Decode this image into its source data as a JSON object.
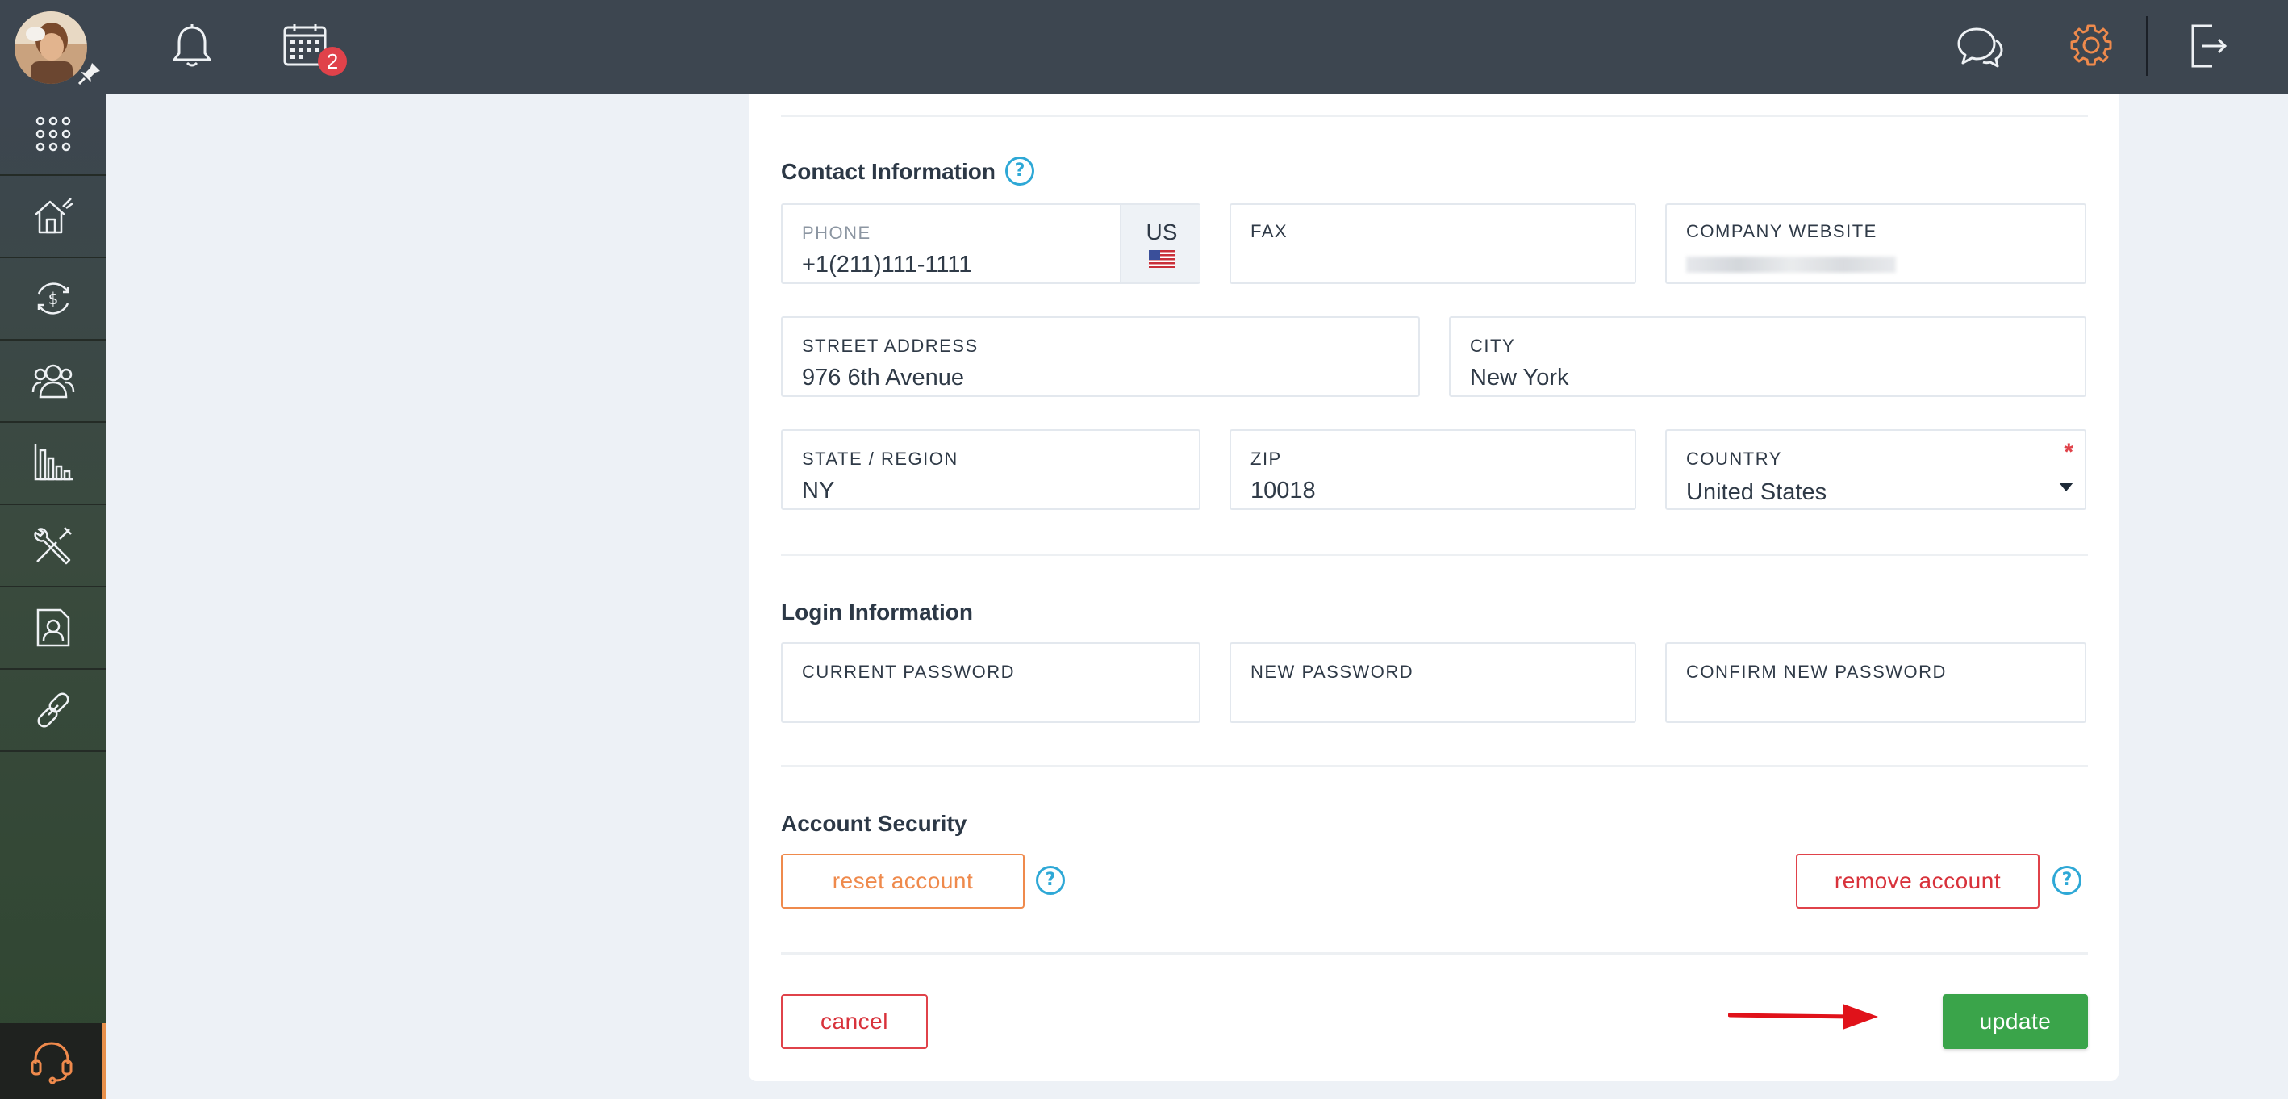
{
  "topbar": {
    "notifications_badge": "2",
    "icons": [
      "bell-icon",
      "calendar-icon",
      "chat-icon",
      "gear-icon",
      "logout-icon"
    ],
    "gear_color": "#ef8a4c"
  },
  "sidebar": {
    "items": [
      "apps-grid-icon",
      "house-icon",
      "dollar-cycle-icon",
      "users-icon",
      "chart-icon",
      "tools-icon",
      "contact-card-icon",
      "link-icon"
    ],
    "support_icon": "headset-icon",
    "support_accent": "#e8904a"
  },
  "contact": {
    "title": "Contact Information",
    "help": "?",
    "phone_label": "PHONE",
    "phone_value": "+1(211)111-1111",
    "country_code": "US",
    "fax_label": "FAX",
    "fax_value": "",
    "website_label": "COMPANY WEBSITE",
    "street_label": "STREET ADDRESS",
    "street_value": "976 6th Avenue",
    "city_label": "CITY",
    "city_value": "New York",
    "state_label": "STATE / REGION",
    "state_value": "NY",
    "zip_label": "ZIP",
    "zip_value": "10018",
    "country_label": "COUNTRY",
    "country_value": "United States",
    "required_mark": "*"
  },
  "login": {
    "title": "Login Information",
    "current_label": "CURRENT PASSWORD",
    "new_label": "NEW PASSWORD",
    "confirm_label": "CONFIRM NEW PASSWORD"
  },
  "security": {
    "title": "Account Security",
    "reset_label": "reset account",
    "remove_label": "remove account",
    "help": "?"
  },
  "actions": {
    "cancel_label": "cancel",
    "update_label": "update"
  },
  "colors": {
    "accent_green": "#3aa44a",
    "danger_red": "#e0424a",
    "warning_orange": "#ef8a4c",
    "help_blue": "#2ea8d6"
  }
}
